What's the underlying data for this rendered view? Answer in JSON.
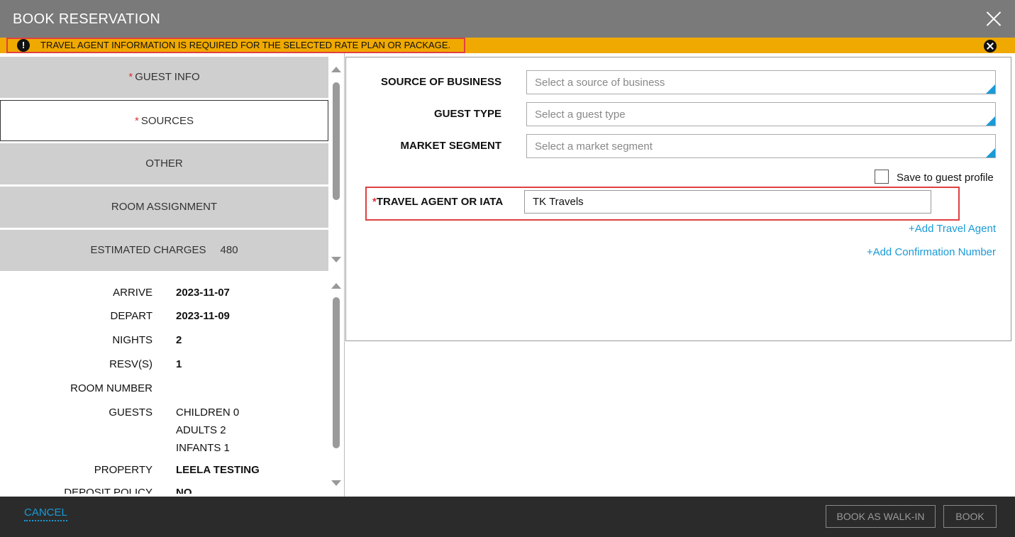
{
  "window": {
    "title": "BOOK RESERVATION"
  },
  "alert": {
    "message": "TRAVEL AGENT INFORMATION IS REQUIRED FOR THE SELECTED RATE PLAN OR PACKAGE.",
    "icon": "!"
  },
  "nav": {
    "items": [
      {
        "label": "GUEST INFO",
        "required": "*",
        "value": ""
      },
      {
        "label": "SOURCES",
        "required": "*",
        "value": ""
      },
      {
        "label": "OTHER",
        "required": "",
        "value": ""
      },
      {
        "label": "ROOM ASSIGNMENT",
        "required": "",
        "value": ""
      },
      {
        "label": "ESTIMATED CHARGES",
        "required": "",
        "value": "480"
      }
    ],
    "active_index": 1
  },
  "summary": {
    "arrive_label": "ARRIVE",
    "arrive": "2023-11-07",
    "depart_label": "DEPART",
    "depart": "2023-11-09",
    "nights_label": "NIGHTS",
    "nights": "2",
    "resvs_label": "RESV(S)",
    "resvs": "1",
    "room_number_label": "ROOM NUMBER",
    "room_number": "",
    "guests_label": "GUESTS",
    "children": "CHILDREN 0",
    "adults": "ADULTS 2",
    "infants": "INFANTS 1",
    "property_label": "PROPERTY",
    "property": "LEELA TESTING",
    "deposit_policy_label": "DEPOSIT POLICY",
    "deposit_policy": "NO"
  },
  "sources": {
    "source_of_business": {
      "label": "SOURCE OF BUSINESS",
      "placeholder": "Select a source of business"
    },
    "guest_type": {
      "label": "GUEST TYPE",
      "placeholder": "Select a guest type"
    },
    "market_segment": {
      "label": "MARKET SEGMENT",
      "placeholder": "Select a market segment"
    },
    "save_to_profile": "Save to guest profile",
    "travel_agent": {
      "required": "*",
      "label": "TRAVEL AGENT OR IATA",
      "value": "TK Travels"
    },
    "add_travel_agent": "+Add Travel Agent",
    "add_confirmation_number": "+Add Confirmation Number"
  },
  "footer": {
    "cancel": "CANCEL",
    "book_walk_in": "BOOK AS WALK-IN",
    "book": "BOOK"
  },
  "colors": {
    "accent": "#1a9ad6",
    "alert": "#f0a900",
    "required": "#dd3333",
    "titlebar": "#7a7a7a",
    "footer": "#2b2b2b"
  }
}
